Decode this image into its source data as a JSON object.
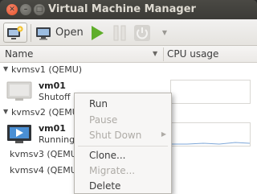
{
  "window": {
    "title": "Virtual Machine Manager"
  },
  "toolbar": {
    "new_icon": "new-vm-icon",
    "open_label": "Open",
    "run_icon": "play-icon",
    "pause_icon": "pause-icon",
    "shutdown_icon": "power-icon",
    "menu_icon": "chevron-down-icon"
  },
  "columns": {
    "name": "Name",
    "cpu": "CPU usage"
  },
  "connections": [
    {
      "label": "kvmsv1 (QEMU)",
      "vms": [
        {
          "name": "vm01",
          "state": "Shutoff"
        }
      ]
    },
    {
      "label": "kvmsv2 (QEMU)",
      "vms": [
        {
          "name": "vm01",
          "state": "Running"
        }
      ]
    },
    {
      "label": "kvmsv3 (QEMU)",
      "vms": []
    },
    {
      "label": "kvmsv4 (QEMU)",
      "vms": []
    }
  ],
  "context_menu": {
    "items": [
      {
        "label": "Run",
        "enabled": true
      },
      {
        "label": "Pause",
        "enabled": false
      },
      {
        "label": "Shut Down",
        "enabled": false,
        "submenu": true
      },
      {
        "label": "Clone...",
        "enabled": true
      },
      {
        "label": "Migrate...",
        "enabled": false
      },
      {
        "label": "Delete",
        "enabled": true
      }
    ]
  },
  "colors": {
    "accent_green": "#5fae2a",
    "graph_line": "#7ea7d8",
    "titlebar": "#3c3b37"
  }
}
